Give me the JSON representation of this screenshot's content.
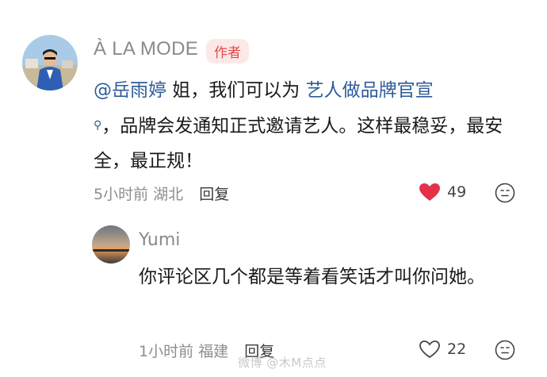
{
  "comment": {
    "username": "À LA MODE",
    "badge": "作者",
    "mention": "@岳雨婷",
    "text_before_link": " 姐，我们可以为 ",
    "link_text": "艺人做品牌官宣",
    "text_after_link": "，品牌会发通知正式邀请艺人。这样最稳妥，最安全，最正规！",
    "time": "5小时前",
    "location": "湖北",
    "reply_label": "回复",
    "likes": "49"
  },
  "reply": {
    "username": "Yumi",
    "text": "你评论区几个都是等着看笑话才叫你问她。",
    "time": "1小时前",
    "location": "福建",
    "reply_label": "回复",
    "likes": "22"
  },
  "watermark": "微博 @木M点点",
  "colors": {
    "liked_heart": "#e5304a",
    "link": "#2e5b9a",
    "badge_text": "#e24a4a",
    "badge_bg": "#fde8e8"
  }
}
